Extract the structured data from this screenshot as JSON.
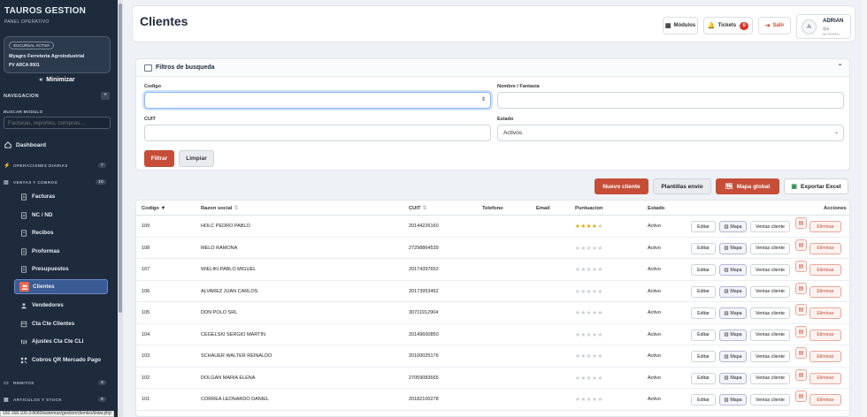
{
  "sidebar": {
    "brand": "TAUROS GESTION",
    "brand_sub": "PANEL OPERATIVO",
    "branch_badge": "SUCURSAL ACTIVA",
    "branch_name": "Myagro Ferreteria Agroindustrial",
    "branch_pv": "PV ARCA 0001",
    "minimize_label": "Minimizar",
    "nav_label": "NAVEGACION",
    "nav_plus": "+",
    "search_label": "BUSCAR MODULO",
    "search_placeholder": "Facturas, reportes, compras...",
    "dashboard": "Dashboard",
    "sections": [
      {
        "label": "OPERACIONES DIARIAS",
        "count": "7"
      },
      {
        "label": "VENTAS Y COBROS",
        "count": "10"
      },
      {
        "label": "REMITOS",
        "count": "4"
      },
      {
        "label": "ARTICULOS Y STOCK",
        "count": "9"
      }
    ],
    "items": [
      {
        "label": "Facturas",
        "icon": "document-icon"
      },
      {
        "label": "NC / ND",
        "icon": "document-icon"
      },
      {
        "label": "Recibos",
        "icon": "receipt-icon"
      },
      {
        "label": "Proformas",
        "icon": "document-icon"
      },
      {
        "label": "Presupuestos",
        "icon": "document-icon"
      },
      {
        "label": "Clientes",
        "icon": "users-icon",
        "active": true
      },
      {
        "label": "Vendedores",
        "icon": "user-icon"
      },
      {
        "label": "Cta Cte Clientes",
        "icon": "ledger-icon"
      },
      {
        "label": "Ajustes Cta Cte CLI",
        "icon": "sliders-icon"
      },
      {
        "label": "Cobros QR Mercado Pago",
        "icon": "qr-icon"
      }
    ]
  },
  "statusbar": "192.168.100.3:8080/sistemas/gestion/clientes/listar.php",
  "header": {
    "title": "Clientes",
    "modulos": "Módulos",
    "tickets": "Tickets",
    "tickets_count": "0",
    "salir": "Salir",
    "user_initial": "A",
    "user_name": "ADRIAN",
    "user_at": "@a",
    "user_role": "MI PERFIL"
  },
  "filters": {
    "title": "Filtros de busqueda",
    "codigo_label": "Codigo",
    "codigo_value": "",
    "nombre_label": "Nombre / Fantasia",
    "nombre_value": "",
    "cuit_label": "CUIT",
    "cuit_value": "",
    "estado_label": "Estado",
    "estado_value": "Activos",
    "filtrar": "Filtrar",
    "limpiar": "Limpiar"
  },
  "toolbar": {
    "nuevo": "Nuevo cliente",
    "plantillas": "Plantillas envio",
    "mapa_global": "Mapa global",
    "exportar": "Exportar Excel"
  },
  "table": {
    "headers": {
      "codigo": "Codigo",
      "razon": "Razon social",
      "cuit": "CUIT",
      "telefono": "Telefono",
      "email": "Email",
      "puntuacion": "Puntuacion",
      "estado": "Estado",
      "acciones": "Acciones"
    },
    "actions": {
      "editar": "Editar",
      "mapa": "Mapa",
      "ventas": "Ventas cliente",
      "eliminar": "Eliminar"
    },
    "rows": [
      {
        "codigo": "109",
        "razon": "HOLC PEDRO PABLO",
        "cuit": "20144226160",
        "telefono": "",
        "email": "",
        "stars": 4,
        "estado": "Activo"
      },
      {
        "codigo": "108",
        "razon": "MELO RAMONA",
        "cuit": "27298864539",
        "telefono": "",
        "email": "",
        "stars": 0,
        "estado": "Activo"
      },
      {
        "codigo": "107",
        "razon": "WIELIKI PABLO MIGUEL",
        "cuit": "20174397652",
        "telefono": "",
        "email": "",
        "stars": 0,
        "estado": "Activo"
      },
      {
        "codigo": "106",
        "razon": "ALVAREZ JUAN CARLOS",
        "cuit": "20173953462",
        "telefono": "",
        "email": "",
        "stars": 0,
        "estado": "Activo"
      },
      {
        "codigo": "105",
        "razon": "DON POLO SRL",
        "cuit": "30711912904",
        "telefono": "",
        "email": "",
        "stars": 0,
        "estado": "Activo"
      },
      {
        "codigo": "104",
        "razon": "CEGELSKI SERGIO MARTIN",
        "cuit": "20149600850",
        "telefono": "",
        "email": "",
        "stars": 0,
        "estado": "Activo"
      },
      {
        "codigo": "103",
        "razon": "SCHAUER WALTER REINALDO",
        "cuit": "20100025176",
        "telefono": "",
        "email": "",
        "stars": 0,
        "estado": "Activo"
      },
      {
        "codigo": "102",
        "razon": "DOLGAN MARIA ELENA",
        "cuit": "27059083665",
        "telefono": "",
        "email": "",
        "stars": 0,
        "estado": "Activo"
      },
      {
        "codigo": "101",
        "razon": "CORREA LEONARDO DANIEL",
        "cuit": "20182100278",
        "telefono": "",
        "email": "",
        "stars": 0,
        "estado": "Activo"
      }
    ]
  },
  "colors": {
    "sidebar_bg": "#1e2b3c",
    "accent_red": "#c64e39",
    "active_item": "#3b5b94",
    "star_gold": "#e0a800",
    "star_empty": "#c8ccd2"
  }
}
